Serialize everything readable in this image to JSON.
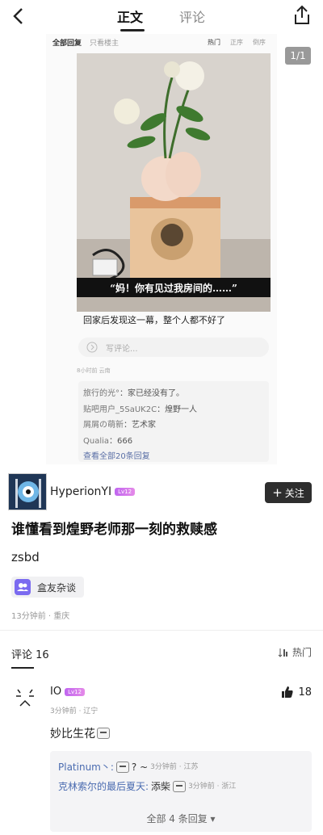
{
  "nav": {
    "tab_main": "正文",
    "tab_comments": "评论"
  },
  "shot": {
    "tab_all": "全部回复",
    "tab_op": "只看楼主",
    "sort_hot": "热门",
    "sort_asc": "正序",
    "sort_desc": "倒序",
    "caption": "“妈！你有见过我房间的……”",
    "title": "回家后发现这一幕，整个人都不好了",
    "comment_placeholder": "写评论...",
    "meta": "8小时前 云南",
    "replies": [
      {
        "name": "旅行的光°",
        "text": "家已经没有了。"
      },
      {
        "name": "贴吧用户_5SaUK2C",
        "text": "煌野一人"
      },
      {
        "name": "屑屑の萌新",
        "text": "艺术家"
      },
      {
        "name": "Qualia",
        "text": "666"
      }
    ],
    "view_all": "查看全部20条回复"
  },
  "page_indicator": "1/1",
  "author": {
    "name": "HyperionYI",
    "level": "Lv12",
    "follow_label": "关注"
  },
  "post": {
    "title": "谁懂看到煌野老师那一刻的救赎感",
    "body": "zsbd",
    "tag": "盒友杂谈",
    "meta": "13分钟前 · 重庆"
  },
  "comments_section": {
    "header": "评论 16",
    "sort_label": "热门"
  },
  "comment": {
    "name": "IO",
    "level": "Lv12",
    "likes": "18",
    "meta": "3分钟前 · 辽宁",
    "text": "妙比生花",
    "replies": [
      {
        "user": "Platinum丶:",
        "text": "?  ~",
        "meta": "3分钟前 · 江苏"
      },
      {
        "user": "克林索尔的最后夏天:",
        "text": "添柴",
        "meta": "3分钟前 · 浙江"
      }
    ],
    "view_all": "全部 4 条回复 ▾"
  }
}
